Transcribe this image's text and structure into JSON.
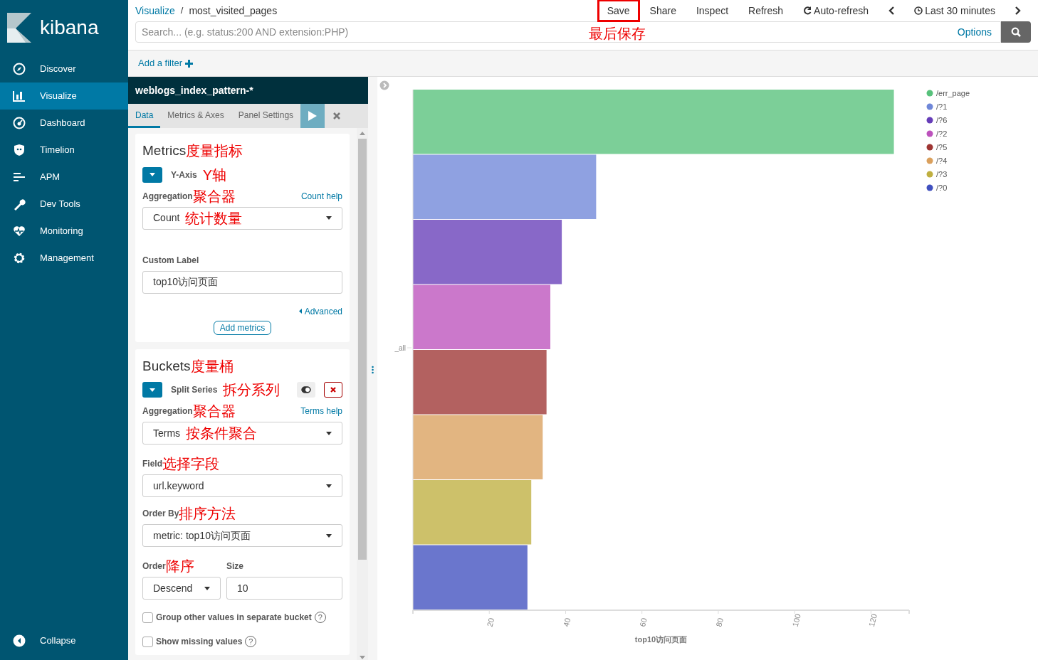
{
  "sidebar": {
    "logo": "kibana",
    "items": [
      {
        "label": "Discover",
        "selected": false
      },
      {
        "label": "Visualize",
        "selected": true
      },
      {
        "label": "Dashboard",
        "selected": false
      },
      {
        "label": "Timelion",
        "selected": false
      },
      {
        "label": "APM",
        "selected": false
      },
      {
        "label": "Dev Tools",
        "selected": false
      },
      {
        "label": "Monitoring",
        "selected": false
      },
      {
        "label": "Management",
        "selected": false
      }
    ],
    "collapse": "Collapse"
  },
  "breadcrumbs": [
    "Visualize",
    "most_visited_pages"
  ],
  "breadcrumb_separator": "/",
  "actions": [
    {
      "label": "Save",
      "kind": "text",
      "highlighted": true,
      "annotation": "最后保存"
    },
    {
      "label": "Share",
      "kind": "text",
      "highlighted": false
    },
    {
      "label": "Inspect",
      "kind": "text",
      "highlighted": false
    },
    {
      "label": "Refresh",
      "kind": "text",
      "highlighted": false
    },
    {
      "label": "Auto-refresh",
      "kind": "refresh",
      "highlighted": false
    },
    {
      "kind": "prev"
    },
    {
      "label": "Last 30 minutes",
      "kind": "clock",
      "highlighted": false
    },
    {
      "kind": "next"
    }
  ],
  "query": {
    "placeholder": "Search... (e.g. status:200 AND extension:PHP)",
    "options": "Options"
  },
  "filter": {
    "add": "Add a filter"
  },
  "editor": {
    "title": "weblogs_index_pattern-*",
    "tabs": [
      {
        "label": "Data",
        "selected": true
      },
      {
        "label": "Metrics & Axes",
        "selected": false
      },
      {
        "label": "Panel Settings",
        "selected": false
      }
    ],
    "metrics": {
      "title": "Metrics",
      "annotation": "度量指标",
      "agg": "Y-Axis",
      "agg_annotation": "Y轴",
      "aggregation_label": "Aggregation",
      "aggregation_annotation": "聚合器",
      "help": "Count help",
      "select": "Count",
      "select_annotation": "统计数量",
      "custom_label": "Custom Label",
      "custom_value": "top10访问页面",
      "advanced": "Advanced",
      "add": "Add metrics"
    },
    "buckets": {
      "title": "Buckets",
      "annotation": "度量桶",
      "agg": "Split Series",
      "agg_annotation": "拆分系列",
      "enabled": true,
      "aggregation_label": "Aggregation",
      "aggregation_annotation": "聚合器",
      "help": "Terms help",
      "select": "Terms",
      "select_annotation": "按条件聚合",
      "field_label": "Field",
      "field_annotation": "选择字段",
      "field": "url.keyword",
      "order_by_label": "Order By",
      "order_by_annotation": "排序方法",
      "order_by": "metric: top10访问页面",
      "order_label": "Order",
      "order_annotation": "降序",
      "order": "Descend",
      "size_label": "Size",
      "size": "10",
      "checks": [
        {
          "label": "Group other values in separate bucket",
          "checked": false,
          "help": "?"
        },
        {
          "label": "Show missing values",
          "checked": false,
          "help": "?"
        }
      ]
    }
  },
  "chart": {
    "chart_data": {
      "type": "bar",
      "orientation": "horizontal",
      "xlabel": "top10访问页面",
      "categories": [
        "_all"
      ],
      "xlim": [
        0,
        130
      ],
      "xticks": [
        20,
        40,
        60,
        80,
        100,
        120
      ],
      "legend": "right",
      "series": [
        {
          "name": "/err_page",
          "color": "#57c17b",
          "values": [
            126
          ]
        },
        {
          "name": "/?1",
          "color": "#6f87d8",
          "values": [
            48
          ]
        },
        {
          "name": "/?6",
          "color": "#663db8",
          "values": [
            39
          ]
        },
        {
          "name": "/?2",
          "color": "#bc52bc",
          "values": [
            36
          ]
        },
        {
          "name": "/?5",
          "color": "#9e3533",
          "values": [
            35
          ]
        },
        {
          "name": "/?4",
          "color": "#daa05d",
          "values": [
            34
          ]
        },
        {
          "name": "/?3",
          "color": "#bfaf40",
          "values": [
            31
          ]
        },
        {
          "name": "/?0",
          "color": "#4050bf",
          "values": [
            30
          ]
        }
      ]
    }
  }
}
